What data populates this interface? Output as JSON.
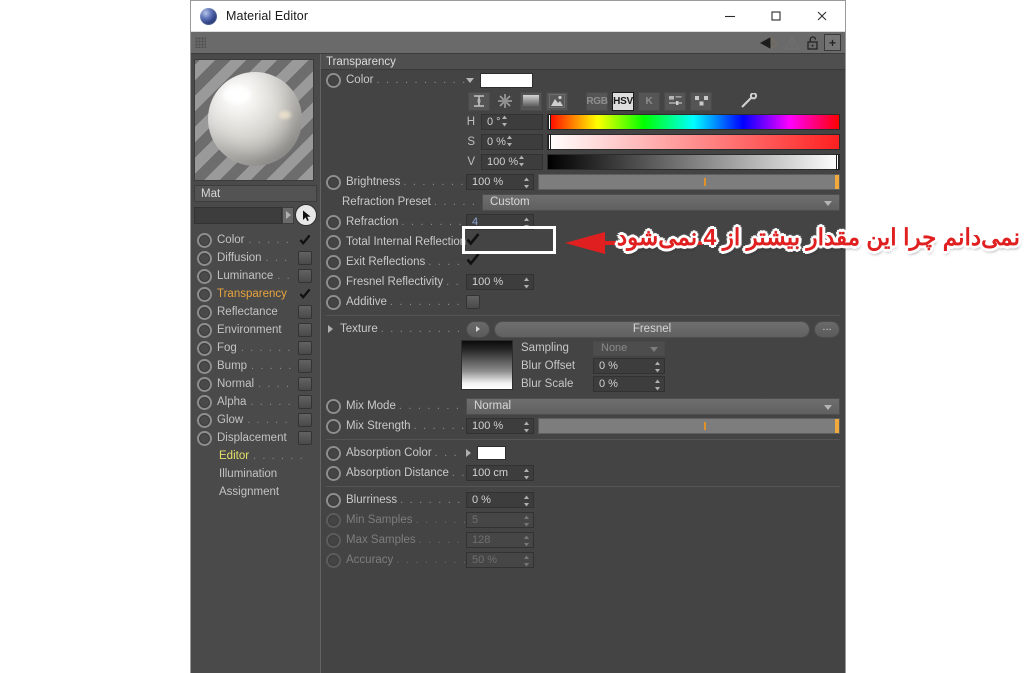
{
  "window": {
    "title": "Material Editor",
    "icon": "material-sphere-icon",
    "minimize_label": "—",
    "maximize_label": "□",
    "close_label": "✕"
  },
  "toolbar": {
    "grip": "drag-grip",
    "icons": [
      "triangle-left-icon",
      "triangle-ghost-icon",
      "triangle-up-icon",
      "lock-open-icon",
      "plus-icon"
    ],
    "plus_label": "+"
  },
  "sidebar": {
    "material_name": "Mat",
    "search_value": "",
    "search_arrow": "▸",
    "cursor_icon": "pointer-arrow-icon",
    "channels": [
      {
        "label": "Color",
        "dots": ". . . . . . .",
        "checked": true,
        "active": false
      },
      {
        "label": "Diffusion",
        "dots": ". . . .",
        "checked": false,
        "active": false
      },
      {
        "label": "Luminance",
        "dots": ". .",
        "checked": false,
        "active": false
      },
      {
        "label": "Transparency",
        "dots": "",
        "checked": true,
        "active": true
      },
      {
        "label": "Reflectance",
        "dots": "",
        "checked": false,
        "active": false
      },
      {
        "label": "Environment",
        "dots": "",
        "checked": false,
        "active": false
      },
      {
        "label": "Fog",
        "dots": ". . . . . . . .",
        "checked": false,
        "active": false
      },
      {
        "label": "Bump",
        "dots": ". . . . . . .",
        "checked": false,
        "active": false
      },
      {
        "label": "Normal",
        "dots": ". . . . . .",
        "checked": false,
        "active": false
      },
      {
        "label": "Alpha",
        "dots": ". . . . . . .",
        "checked": false,
        "active": false
      },
      {
        "label": "Glow",
        "dots": ". . . . . . . .",
        "checked": false,
        "active": false
      },
      {
        "label": "Displacement",
        "dots": "",
        "checked": false,
        "active": false
      }
    ],
    "sub_items": [
      {
        "label": "Editor",
        "dots": ". . . . . .",
        "highlight": true
      },
      {
        "label": "Illumination",
        "dots": "",
        "highlight": false
      },
      {
        "label": "Assignment",
        "dots": "",
        "highlight": false
      }
    ]
  },
  "panel": {
    "section_title": "Transparency",
    "color": {
      "label": "Color",
      "dots": ". . . . . . . . . . . . .",
      "swatch_hex": "#ffffff",
      "expand_icon": "triangle-down-icon",
      "tools": [
        {
          "name": "range-icon",
          "label": "",
          "selected": false
        },
        {
          "name": "color-wheel-icon",
          "label": "",
          "selected": false
        },
        {
          "name": "gradient-icon",
          "label": "",
          "selected": false
        },
        {
          "name": "image-icon",
          "label": "",
          "selected": false
        },
        {
          "name": "rgb-mode",
          "label": "RGB",
          "selected": false
        },
        {
          "name": "hsv-mode",
          "label": "HSV",
          "selected": true
        },
        {
          "name": "kelvin-mode",
          "label": "K",
          "selected": false
        },
        {
          "name": "sliders-icon",
          "label": "",
          "selected": false
        },
        {
          "name": "swatches-icon",
          "label": "",
          "selected": false
        },
        {
          "name": "eyedropper-icon",
          "label": "",
          "selected": false
        }
      ],
      "hsv": [
        {
          "letter": "H",
          "value": "0 °",
          "handle_pct": 0
        },
        {
          "letter": "S",
          "value": "0 %",
          "handle_pct": 0
        },
        {
          "letter": "V",
          "value": "100 %",
          "handle_pct": 100
        }
      ]
    },
    "brightness": {
      "label": "Brightness",
      "dots": ". . . . . . . . . . .",
      "value": "100 %",
      "slider_pct": 100,
      "tick_pct": 55
    },
    "refraction_preset": {
      "label": "Refraction Preset",
      "dots": ". . . . . .",
      "value": "Custom"
    },
    "refraction": {
      "label": "Refraction",
      "dots": ". . . . . . . . . . .",
      "value": "4",
      "highlighted": true
    },
    "total_internal_reflection": {
      "label": "Total Internal Reflection",
      "dots": "",
      "checked": true
    },
    "exit_reflections": {
      "label": "Exit Reflections",
      "dots": ". . . . . . .",
      "checked": true
    },
    "fresnel_reflectivity": {
      "label": "Fresnel Reflectivity",
      "dots": ". . . .",
      "value": "100 %"
    },
    "additive": {
      "label": "Additive",
      "dots": ". . . . . . . . . . . .",
      "checked": false
    },
    "texture": {
      "label": "Texture",
      "dots": ". . . . . . . . . . . . .",
      "expand_icon": "triangle-right-icon",
      "play_icon": "triangle-right-small-icon",
      "name": "Fresnel",
      "more_label": "...",
      "sampling": {
        "label": "Sampling",
        "value": "None"
      },
      "blur_offset": {
        "label": "Blur Offset",
        "value": "0 %"
      },
      "blur_scale": {
        "label": "Blur Scale",
        "value": "0 %"
      }
    },
    "mix_mode": {
      "label": "Mix Mode",
      "dots": ". . . . . . . . . . .",
      "value": "Normal"
    },
    "mix_strength": {
      "label": "Mix Strength",
      "dots": ". . . . . . . . .",
      "value": "100 %",
      "slider_pct": 100,
      "tick_pct": 55
    },
    "absorption_color": {
      "label": "Absorption Color",
      "dots": ". . .",
      "swatch_hex": "#ffffff",
      "expand_icon": "triangle-right-icon"
    },
    "absorption_distance": {
      "label": "Absorption Distance",
      "dots": ". . .",
      "value": "100 cm"
    },
    "blurriness": {
      "label": "Blurriness",
      "dots": ". . . . . . . . . . . .",
      "value": "0 %",
      "disabled": false
    },
    "min_samples": {
      "label": "Min Samples",
      "dots": ". . . . . . . . .",
      "value": "5",
      "disabled": true
    },
    "max_samples": {
      "label": "Max Samples",
      "dots": ". . . . . . . . .",
      "value": "128",
      "disabled": true
    },
    "accuracy": {
      "label": "Accuracy",
      "dots": ". . . . . . . . . . . . .",
      "value": "50 %",
      "disabled": true
    }
  },
  "annotation": {
    "text": "نمی‌دانم چرا این مقدار بیشتر از 4 نمی‌شود",
    "color": "#e02020",
    "arrow": "arrow-left-icon",
    "highlight_box": "refraction-field-highlight"
  }
}
